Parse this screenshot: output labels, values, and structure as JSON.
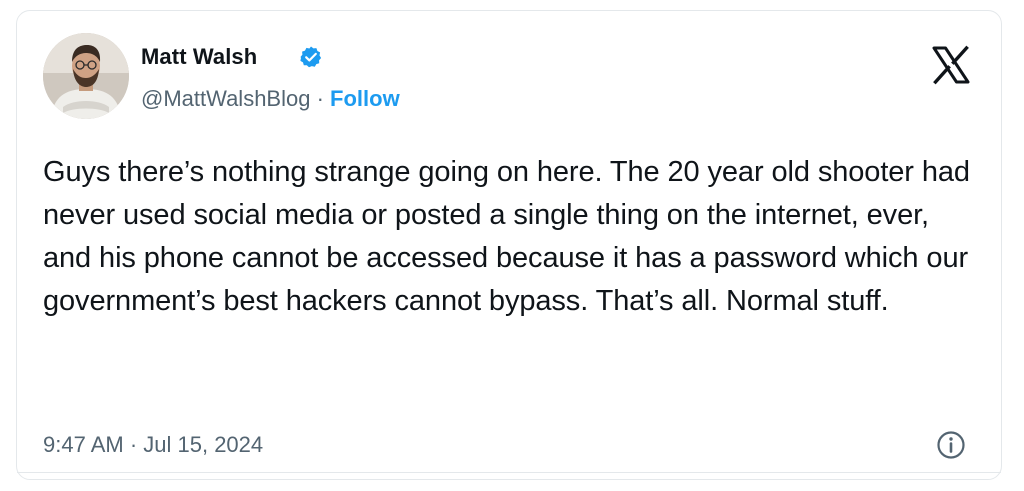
{
  "tweet": {
    "author_name": "Matt Walsh",
    "handle": "@MattWalshBlog",
    "separator": "·",
    "follow_label": "Follow",
    "text": "Guys there’s nothing strange going on here. The 20 year old shooter had never used social media or posted a single thing on the internet, ever, and his phone cannot be accessed because it has a password which our government’s best hackers cannot bypass. That’s all. Normal stuff.",
    "timestamp": "9:47 AM · Jul 15, 2024"
  },
  "icons": {
    "verified": "verified-badge-icon",
    "platform": "x-logo-icon",
    "info": "info-icon"
  },
  "colors": {
    "accent": "#1d9bf0",
    "text_primary": "#0f1419",
    "text_secondary": "#536471",
    "border": "#e4e8eb"
  }
}
